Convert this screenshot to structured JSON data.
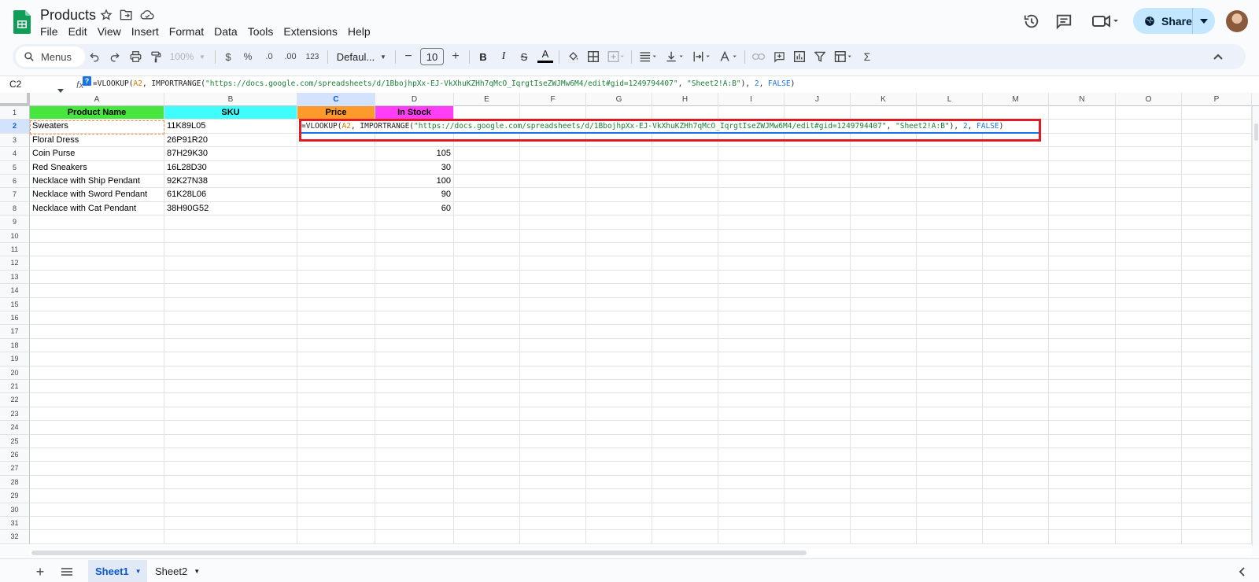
{
  "header": {
    "doc_title": "Products",
    "menu": [
      "File",
      "Edit",
      "View",
      "Insert",
      "Format",
      "Data",
      "Tools",
      "Extensions",
      "Help"
    ],
    "share_label": "Share"
  },
  "toolbar": {
    "menus_label": "Menus",
    "zoom": "100%",
    "currency": "$",
    "percent": "%",
    "decrease_decimal": ".0",
    "increase_decimal": ".00",
    "more_formats": "123",
    "font": "Defaul...",
    "font_size": "10",
    "bold": "B",
    "italic": "I",
    "strikethrough": "S",
    "text_color": "A",
    "sum": "Σ"
  },
  "formula_bar": {
    "name_box": "C2",
    "fx": "fx",
    "help": "?",
    "formula": {
      "p1": "=VLOOKUP(",
      "ref": "A2",
      "p2": ", IMPORTRANGE(",
      "url": "\"https://docs.google.com/spreadsheets/d/1BbojhpXx-EJ-VkXhuKZHh7qMcO_IqrgtIseZWJMw6M4/edit#gid=1249794407\"",
      "p3": ", ",
      "range": "\"Sheet2!A:B\"",
      "p4": "), ",
      "idx": "2",
      "p5": ", ",
      "bool": "FALSE",
      "p6": ")"
    }
  },
  "grid": {
    "columns": [
      "A",
      "B",
      "C",
      "D",
      "E",
      "F",
      "G",
      "H",
      "I",
      "J",
      "K",
      "L",
      "M",
      "N",
      "O",
      "P"
    ],
    "row_numbers": [
      "1",
      "2",
      "3",
      "4",
      "5",
      "6",
      "7",
      "8",
      "9",
      "10",
      "11",
      "12",
      "13",
      "14",
      "15",
      "16",
      "17",
      "18",
      "19",
      "20",
      "21",
      "22",
      "23",
      "24",
      "25",
      "26",
      "27",
      "28",
      "29",
      "30",
      "31",
      "32"
    ],
    "headers": {
      "a": "Product Name",
      "b": "SKU",
      "c": "Price",
      "d": "In Stock"
    },
    "header_colors": {
      "a": "#47e63f",
      "b": "#3ffdfc",
      "c": "#fe9a2b",
      "d": "#ff3ff8"
    },
    "rows": [
      {
        "name": "Sweaters",
        "sku": "11K89L05",
        "stock": ""
      },
      {
        "name": "Floral Dress",
        "sku": "26P91R20",
        "stock": ""
      },
      {
        "name": "Coin Purse",
        "sku": "87H29K30",
        "stock": "105"
      },
      {
        "name": "Red Sneakers",
        "sku": "16L28D30",
        "stock": "30"
      },
      {
        "name": "Necklace with Ship Pendant",
        "sku": "92K27N38",
        "stock": "100"
      },
      {
        "name": "Necklace with Sword Pendant",
        "sku": "61K28L06",
        "stock": "90"
      },
      {
        "name": "Necklace with Cat Pendant",
        "sku": "38H90G52",
        "stock": "60"
      }
    ]
  },
  "tabs": [
    {
      "label": "Sheet1",
      "active": true
    },
    {
      "label": "Sheet2",
      "active": false
    }
  ],
  "colors": {
    "accent": "#0b57d0",
    "highlight": "#e01b24",
    "share_bg": "#c2e7ff"
  }
}
